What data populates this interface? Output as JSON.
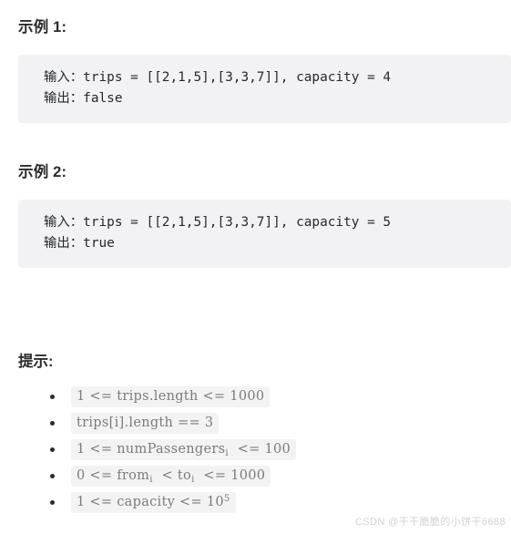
{
  "examples": [
    {
      "heading": "示例 1:",
      "input_line": "输入：trips = [[2,1,5],[3,3,7]], capacity = 4",
      "output_line": "输出：false"
    },
    {
      "heading": "示例 2:",
      "input_line": "输入：trips = [[2,1,5],[3,3,7]], capacity = 5",
      "output_line": "输出：true"
    }
  ],
  "hints": {
    "heading": "提示:",
    "items": [
      {
        "pre": "1 <= trips.length <= 1000",
        "sub": "",
        "post": "",
        "sup": ""
      },
      {
        "pre": "trips[i].length == 3",
        "sub": "",
        "post": "",
        "sup": ""
      },
      {
        "pre": "1 <= numPassengers",
        "sub": "i",
        "post": "  <= 100",
        "sup": ""
      },
      {
        "pre": "0 <= from",
        "sub": "i",
        "post": "  < to",
        "sub2": "i",
        "post2": "  <= 1000",
        "sup": ""
      },
      {
        "pre": "1 <= capacity <= 10",
        "sub": "",
        "post": "",
        "sup": "5"
      }
    ]
  },
  "watermark": "CSDN @干干脆脆的小饼干6688",
  "colors": {
    "code_block_bg": "#f2f2f4",
    "inline_code_bg": "#f3f3f3",
    "inline_code_text": "#7b7b7b",
    "heading_text": "#2b2b2b",
    "watermark_text": "#d2d2d2"
  }
}
